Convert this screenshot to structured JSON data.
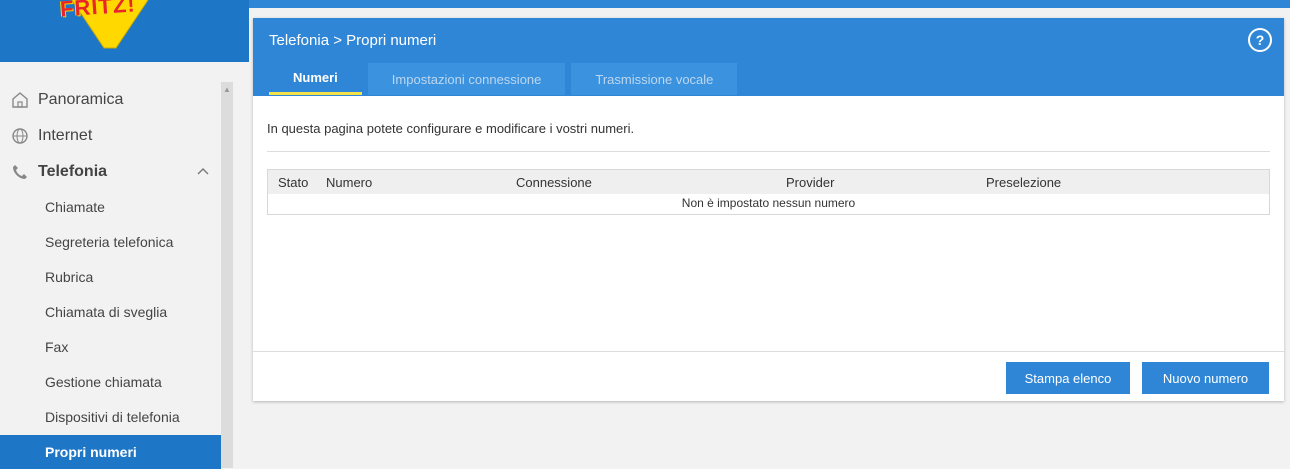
{
  "logo": {
    "text": "FRITZ!"
  },
  "sidebar": {
    "items": [
      {
        "label": "Panoramica",
        "icon": "home-icon"
      },
      {
        "label": "Internet",
        "icon": "globe-icon"
      },
      {
        "label": "Telefonia",
        "icon": "phone-icon",
        "expanded": true
      }
    ],
    "subitems": [
      "Chiamate",
      "Segreteria telefonica",
      "Rubrica",
      "Chiamata di sveglia",
      "Fax",
      "Gestione chiamata",
      "Dispositivi di telefonia",
      "Propri numeri"
    ],
    "active_subitem": "Propri numeri"
  },
  "header": {
    "breadcrumb": "Telefonia > Propri numeri",
    "help": "?"
  },
  "tabs": [
    {
      "label": "Numeri",
      "active": true
    },
    {
      "label": "Impostazioni connessione",
      "active": false
    },
    {
      "label": "Trasmissione vocale",
      "active": false
    }
  ],
  "main": {
    "intro": "In questa pagina potete configurare e modificare i vostri numeri.",
    "table": {
      "columns": [
        "Stato",
        "Numero",
        "Connessione",
        "Provider",
        "Preselezione"
      ],
      "empty_text": "Non è impostato nessun numero"
    }
  },
  "buttons": {
    "print": "Stampa elenco",
    "new": "Nuovo numero"
  },
  "colors": {
    "accent": "#2f86d6",
    "accent_dark": "#1e76c6",
    "tab_indicator": "#f5e14a"
  }
}
